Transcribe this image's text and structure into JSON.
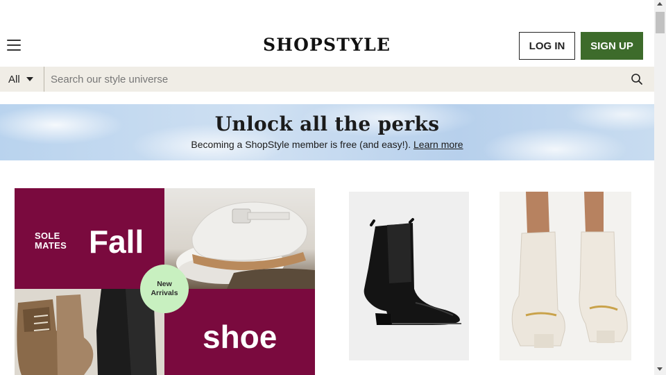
{
  "header": {
    "menu_icon": "hamburger-menu-icon",
    "logo_text": "SHOPSTYLE",
    "login_label": "LOG IN",
    "signup_label": "SIGN UP",
    "signup_color": "#3d6b2b"
  },
  "search": {
    "category": "All",
    "placeholder": "Search our style universe",
    "icon": "search-icon"
  },
  "banner": {
    "title": "Unlock all the perks",
    "subtitle": "Becoming a ShopStyle member is free (and easy!).",
    "link_label": "Learn more"
  },
  "promo": {
    "tagline_line1": "SOLE",
    "tagline_line2": "MATES",
    "headline_top": "Fall",
    "headline_bottom": "shoe",
    "badge_line1": "New",
    "badge_line2": "Arrivals",
    "brand_color": "#7a0a3e",
    "badge_color": "#c8f0c0"
  },
  "products": [
    {
      "image": "black-chelsea-boot-image"
    },
    {
      "image": "white-knee-boots-image"
    }
  ]
}
